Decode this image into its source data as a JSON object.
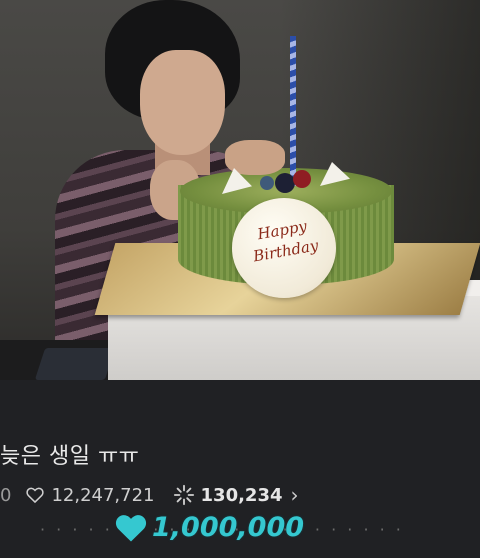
{
  "post": {
    "title": "늦은 생일 ㅠㅠ",
    "row_fragment": "0",
    "likes": "12,247,721",
    "comments": "130,234",
    "subtext": "· · ·   · · · · ·   · · · · · · · ·  · ·  · ·  · ·  ·"
  },
  "plaque": {
    "text": "Happy\nBirthday"
  },
  "milestone": {
    "count": "1,000,000"
  },
  "icons": {
    "heart": "heart-icon",
    "comments": "sparkle-icon",
    "chevron": "chevron-right-icon",
    "milestone_heart": "filled-heart-icon"
  },
  "colors": {
    "background": "#202124",
    "accent": "#35c8d0",
    "text": "#e9e9e9"
  }
}
